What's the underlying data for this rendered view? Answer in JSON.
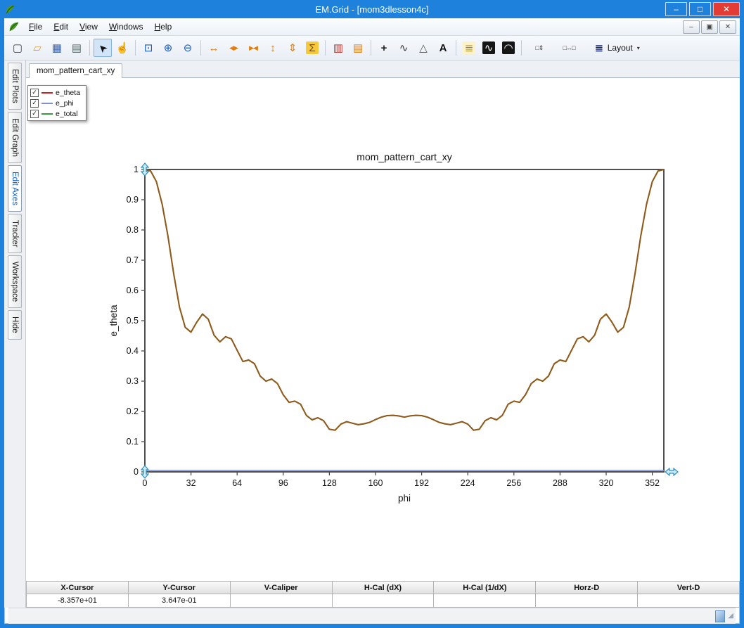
{
  "window": {
    "title": "EM.Grid - [mom3dlesson4c]",
    "caption_buttons": [
      {
        "name": "minimize-button",
        "glyph": "–",
        "close": false
      },
      {
        "name": "maximize-button",
        "glyph": "□",
        "close": false
      },
      {
        "name": "close-button",
        "glyph": "✕",
        "close": true
      }
    ]
  },
  "menu": {
    "items": [
      "File",
      "Edit",
      "View",
      "Windows",
      "Help"
    ],
    "mdi_buttons": [
      {
        "name": "mdi-minimize-button",
        "glyph": "–"
      },
      {
        "name": "mdi-restore-button",
        "glyph": "▣"
      },
      {
        "name": "mdi-close-button",
        "glyph": "✕"
      }
    ]
  },
  "toolbar": {
    "groups": [
      {
        "icons": [
          {
            "name": "new-file",
            "glyph": "▢",
            "color": "#445"
          },
          {
            "name": "open-file",
            "glyph": "▱",
            "color": "#d69a3c"
          },
          {
            "name": "save-file",
            "glyph": "▦",
            "color": "#3a5fa8"
          },
          {
            "name": "print",
            "glyph": "▤",
            "color": "#566"
          }
        ]
      },
      {
        "icons": [
          {
            "name": "pointer-select",
            "glyph": "➤",
            "color": "#111",
            "selected": true,
            "rotate": -135
          },
          {
            "name": "pan-hand",
            "glyph": "☝",
            "color": "#b8863c"
          }
        ]
      },
      {
        "icons": [
          {
            "name": "zoom-window",
            "glyph": "⊡",
            "color": "#1c58b0"
          },
          {
            "name": "zoom-in",
            "glyph": "⊕",
            "color": "#1c58b0"
          },
          {
            "name": "zoom-out",
            "glyph": "⊖",
            "color": "#1c58b0"
          }
        ]
      },
      {
        "icons": [
          {
            "name": "expand-x-axis",
            "glyph": "↔",
            "color": "#e07e10"
          },
          {
            "name": "shift-x-axis",
            "glyph": "◀▶",
            "color": "#e07e10",
            "small": true
          },
          {
            "name": "compress-x-axis",
            "glyph": "▶◀",
            "color": "#e07e10",
            "small": true
          },
          {
            "name": "expand-y-axis",
            "glyph": "↕",
            "color": "#e07e10"
          },
          {
            "name": "shift-y-axis",
            "glyph": "⇕",
            "color": "#e07e10"
          },
          {
            "name": "autoscale-sigma",
            "glyph": "Σ",
            "color": "#6b4d00",
            "bg": "#f6c83c"
          }
        ]
      },
      {
        "icons": [
          {
            "name": "vertical-marker-lines",
            "glyph": "▥",
            "color": "#c03028"
          },
          {
            "name": "horizontal-marker-lines",
            "glyph": "▤",
            "color": "#e07e10"
          }
        ]
      },
      {
        "icons": [
          {
            "name": "crosshair-cursor",
            "glyph": "+",
            "color": "#222",
            "bold": true
          },
          {
            "name": "axes-curve",
            "glyph": "∿",
            "color": "#333"
          },
          {
            "name": "slope-triangle",
            "glyph": "△",
            "color": "#555"
          },
          {
            "name": "text-annotation",
            "glyph": "A",
            "color": "#111",
            "bold": true
          }
        ]
      },
      {
        "icons": [
          {
            "name": "notes-page",
            "glyph": "≣",
            "color": "#a08020",
            "bg": "#fdf2c8"
          },
          {
            "name": "fft-wave-1",
            "glyph": "∿",
            "color": "#ffffff",
            "bg": "#151515"
          },
          {
            "name": "fft-wave-2",
            "glyph": "◠",
            "color": "#ffffff",
            "bg": "#151515"
          }
        ]
      },
      {
        "icons": [
          {
            "name": "fit-vertical-range",
            "glyph": "□⇕",
            "color": "#333",
            "wide": true,
            "small": true
          },
          {
            "name": "fit-horizontal-range",
            "glyph": "□↔□",
            "color": "#333",
            "wide": true,
            "small": true
          }
        ]
      }
    ],
    "layout_button": {
      "icon_glyph": "≣",
      "label": "Layout",
      "caret": "▾"
    }
  },
  "sidebar": {
    "tabs": [
      {
        "label": "Edit Plots",
        "active": false
      },
      {
        "label": "Edit Graph",
        "active": false
      },
      {
        "label": "Edit Axes",
        "active": true
      },
      {
        "label": "Tracker",
        "active": false
      },
      {
        "label": "Workspace",
        "active": false
      },
      {
        "label": "Hide",
        "active": false
      }
    ]
  },
  "document": {
    "tab_label": "mom_pattern_cart_xy"
  },
  "legend": {
    "items": [
      {
        "label": "e_theta",
        "color": "#cc2020",
        "checked": true
      },
      {
        "label": "e_phi",
        "color": "#8090c8",
        "checked": true
      },
      {
        "label": "e_total",
        "color": "#3c9a3c",
        "checked": true
      }
    ]
  },
  "chart_data": {
    "type": "line",
    "title": "mom_pattern_cart_xy",
    "xlabel": "phi",
    "ylabel": "e_theta",
    "xlim": [
      0,
      360
    ],
    "ylim": [
      0,
      1
    ],
    "xticks": [
      0,
      32,
      64,
      96,
      128,
      160,
      192,
      224,
      256,
      288,
      320,
      352
    ],
    "yticks": [
      0,
      0.1,
      0.2,
      0.3,
      0.4,
      0.5,
      0.6,
      0.7,
      0.8,
      0.9,
      1
    ],
    "grid": false,
    "legend_position": "top-left-overlay",
    "x_step_deg": 4,
    "symmetric_about_deg": 180,
    "series": [
      {
        "name": "e_theta",
        "color": "#cc2800",
        "half_values": [
          1.0,
          0.995,
          0.96,
          0.885,
          0.78,
          0.655,
          0.545,
          0.478,
          0.462,
          0.495,
          0.522,
          0.505,
          0.452,
          0.43,
          0.447,
          0.44,
          0.402,
          0.365,
          0.37,
          0.358,
          0.317,
          0.3,
          0.307,
          0.292,
          0.255,
          0.23,
          0.234,
          0.224,
          0.187,
          0.172,
          0.179,
          0.169,
          0.141,
          0.138,
          0.158,
          0.166,
          0.161,
          0.156,
          0.159,
          0.164,
          0.173,
          0.181,
          0.186,
          0.187,
          0.185,
          0.181
        ]
      },
      {
        "name": "e_phi",
        "color": "#8090c8",
        "constant_value": 0.005
      },
      {
        "name": "e_total",
        "color": "#3c9a3c",
        "same_as": "e_theta",
        "overlay_opacity": 0.45
      }
    ]
  },
  "readout": {
    "columns": [
      "X-Cursor",
      "Y-Cursor",
      "V-Caliper",
      "H-Cal (dX)",
      "H-Cal (1/dX)",
      "Horz-D",
      "Vert-D"
    ],
    "values": [
      "-8.357e+01",
      "3.647e-01",
      "",
      "",
      "",
      "",
      ""
    ]
  }
}
